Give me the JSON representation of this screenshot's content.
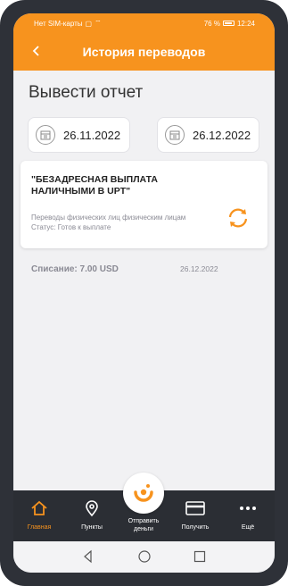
{
  "status_bar": {
    "carrier": "Нет SIM-карты",
    "battery": "76 %",
    "time": "12:24"
  },
  "header": {
    "title": "История переводов"
  },
  "report": {
    "title": "Вывести отчет",
    "date_from": "26.11.2022",
    "date_to": "26.12.2022"
  },
  "transfer": {
    "title": "\"БЕЗАДРЕСНАЯ ВЫПЛАТА НАЛИЧНЫМИ В UPT\"",
    "description": "Переводы физических лиц физическим лицам",
    "status": "Статус: Готов к выплате",
    "amount": "Списание: 7.00 USD",
    "date": "26.12.2022"
  },
  "nav": {
    "home": "Главная",
    "points": "Пункты",
    "send": "Отправить деньги",
    "receive": "Получить",
    "more": "Ещё"
  },
  "colors": {
    "accent": "#f7931e",
    "nav_background": "#2b2e34"
  }
}
